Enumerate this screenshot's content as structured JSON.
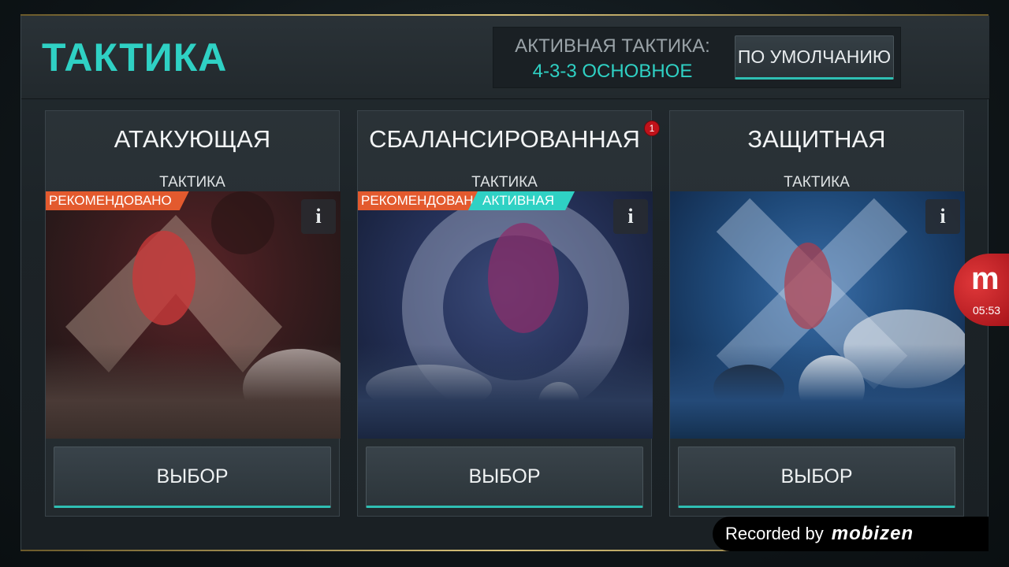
{
  "header": {
    "title": "ТАКТИКА",
    "active_label": "АКТИВНАЯ ТАКТИКА:",
    "active_value": "4-3-3 ОСНОВНОЕ",
    "default_button": "ПО УМОЛЧАНИЮ"
  },
  "cards": [
    {
      "title": "АТАКУЮЩАЯ",
      "subtitle": "ТАКТИКА",
      "tag_recommended": "РЕКОМЕНДОВАНО",
      "info": "i",
      "select": "ВЫБОР"
    },
    {
      "title": "СБАЛАНСИРОВАННАЯ",
      "subtitle": "ТАКТИКА",
      "tag_recommended": "РЕКОМЕНДОВАНО",
      "tag_active": "АКТИВНАЯ",
      "info": "i",
      "select": "ВЫБОР",
      "badge": "1"
    },
    {
      "title": "ЗАЩИТНАЯ",
      "subtitle": "ТАКТИКА",
      "info": "i",
      "select": "ВЫБОР"
    }
  ],
  "overlay": {
    "mobizen_letter": "m",
    "timer": "05:53",
    "recorded_text": "Recorded by",
    "recorded_brand": "mobizen"
  },
  "colors": {
    "accent": "#2fd1c4",
    "recommended": "#e35a2e",
    "badge": "#c0121a"
  }
}
